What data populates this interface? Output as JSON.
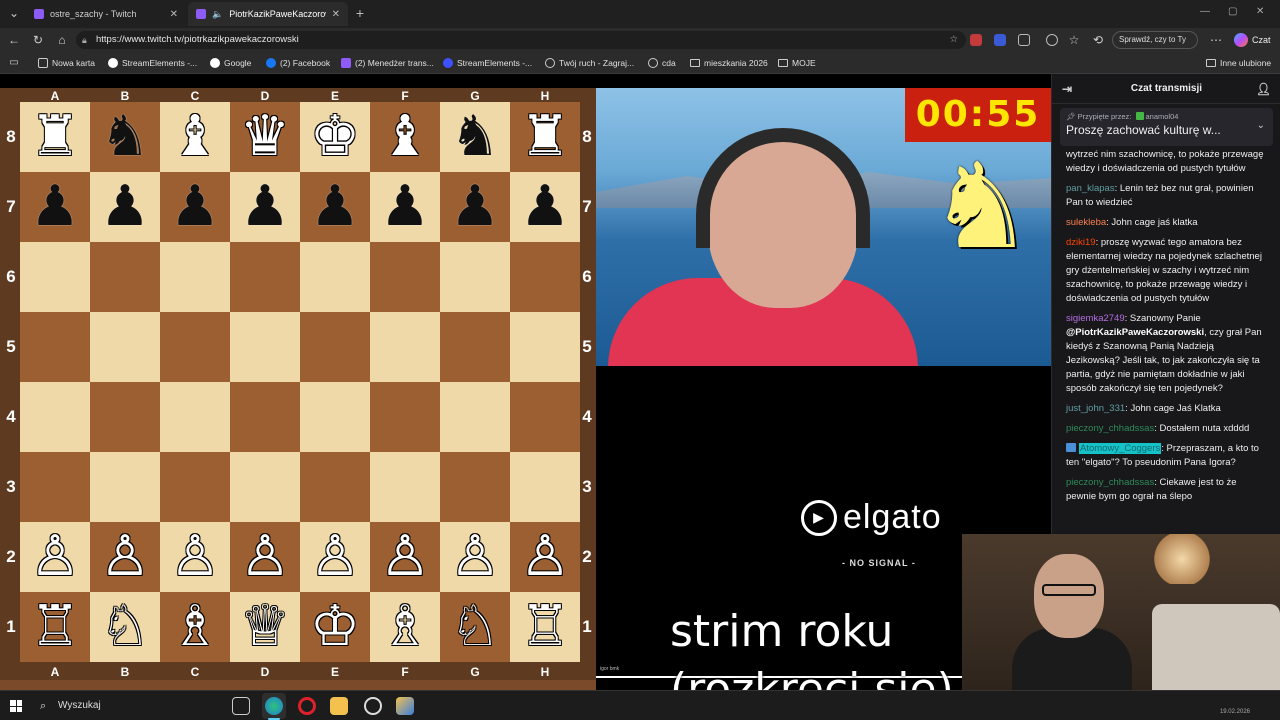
{
  "tabs": [
    {
      "title": "ostre_szachy - Twitch",
      "active": false
    },
    {
      "title": "PiotrKazikPaweKaczorowski -",
      "active": true
    }
  ],
  "address": {
    "url": "https://www.twitch.tv/piotrkazikpawekaczorowski"
  },
  "toolbar": {
    "sprawdz_label": "Sprawdź, czy to Ty",
    "czat_label": "Czat"
  },
  "bookmarks": [
    {
      "label": "Nowa karta",
      "icon": "newtab-icon",
      "color": "#ffffff"
    },
    {
      "label": "StreamElements -...",
      "icon": "streamelements-icon",
      "color": "#ffffff"
    },
    {
      "label": "Google",
      "icon": "google-icon",
      "color": "#4285f4"
    },
    {
      "label": "(2) Facebook",
      "icon": "facebook-icon",
      "color": "#1877f2"
    },
    {
      "label": "(2) Menedżer trans...",
      "icon": "twitch-icon",
      "color": "#8f5bf6"
    },
    {
      "label": "StreamElements -...",
      "icon": "streamelements-icon",
      "color": "#3f51ff"
    },
    {
      "label": "Twój ruch - Zagraj...",
      "icon": "chess-icon",
      "color": "#cccccc"
    },
    {
      "label": "cda",
      "icon": "globe-icon",
      "color": "#cccccc"
    },
    {
      "label": "mieszkania 2026",
      "icon": "folder-icon",
      "color": "#cccccc"
    },
    {
      "label": "MOJE",
      "icon": "folder-icon",
      "color": "#cccccc"
    }
  ],
  "bookmarks_other": "Inne ulubione",
  "board": {
    "files": [
      "A",
      "B",
      "C",
      "D",
      "E",
      "F",
      "G",
      "H"
    ],
    "ranks": [
      "8",
      "7",
      "6",
      "5",
      "4",
      "3",
      "2",
      "1"
    ],
    "position": [
      [
        "♜",
        "♞",
        "♝",
        "♛",
        "♚",
        "♝",
        "♞",
        "♜"
      ],
      [
        "♟",
        "♟",
        "♟",
        "♟",
        "♟",
        "♟",
        "♟",
        "♟"
      ],
      [
        "",
        "",
        "",
        "",
        "",
        "",
        "",
        ""
      ],
      [
        "",
        "",
        "",
        "",
        "",
        "",
        "",
        ""
      ],
      [
        "",
        "",
        "",
        "",
        "",
        "",
        "",
        ""
      ],
      [
        "",
        "",
        "",
        "",
        "",
        "",
        "",
        ""
      ],
      [
        "♙",
        "♙",
        "♙",
        "♙",
        "♙",
        "♙",
        "♙",
        "♙"
      ],
      [
        "♖",
        "♘",
        "♗",
        "♕",
        "♔",
        "♗",
        "♘",
        "♖"
      ]
    ],
    "piece_colors": [
      [
        "w",
        "b",
        "w",
        "w",
        "w",
        "w",
        "b",
        "w"
      ],
      [
        "b",
        "b",
        "b",
        "b",
        "b",
        "b",
        "b",
        "b"
      ],
      [
        "",
        "",
        "",
        "",
        "",
        "",
        "",
        ""
      ],
      [
        "",
        "",
        "",
        "",
        "",
        "",
        "",
        ""
      ],
      [
        "",
        "",
        "",
        "",
        "",
        "",
        "",
        ""
      ],
      [
        "",
        "",
        "",
        "",
        "",
        "",
        "",
        ""
      ],
      [
        "w",
        "w",
        "w",
        "w",
        "w",
        "w",
        "w",
        "w"
      ],
      [
        "w",
        "w",
        "w",
        "w",
        "w",
        "w",
        "w",
        "w"
      ]
    ]
  },
  "stream": {
    "timer": "00:55",
    "elgato": "elgato",
    "no_signal": "- NO SIGNAL -",
    "tiny_label": "igor bmk",
    "overlay_line1": "strim roku",
    "overlay_line2": "(rozkreci sie)"
  },
  "chat": {
    "title": "Czat transmisji",
    "pinned_by_prefix": "Przypięte przez:",
    "pinned_by_user": "anamol04",
    "pinned_message": "Proszę zachować kulturę w...",
    "messages": [
      {
        "user": "",
        "color": "#efeff1",
        "text": "wytrzeć nim szachownicę, to pokaże przewagę wiedzy i doświadczenia od pustych tytułów"
      },
      {
        "user": "pan_klapas",
        "color": "#5f9ea0",
        "text": ": Lenin też bez nut grał, powinien Pan to wiedzieć"
      },
      {
        "user": "sulekleba",
        "color": "#ff7f50",
        "text": ": John cage jaś klatka"
      },
      {
        "user": "dziki19",
        "color": "#ff4500",
        "text": ": proszę wyzwać tego amatora bez elementarnej wiedzy na pojedynek szlachetnej gry dżentelmeńskiej w szachy i wytrzeć nim szachownicę, to pokaże przewagę wiedzy i doświadczenia od pustych tytułów"
      },
      {
        "user": "sigiemka2749",
        "color": "#b36ee0",
        "text": ": Szanowny Panie ",
        "mention": "@PiotrKazikPaweKaczorowski",
        "text2": ", czy grał Pan kiedyś z Szanowną Panią Nadzieją Jezikowską? Jeśli tak, to jak zakończyła się ta partia, gdyż nie pamiętam dokładnie w jaki sposób zakończył się ten pojedynek?"
      },
      {
        "user": "just_john_331",
        "color": "#5f9ea0",
        "text": ": John cage Jaś Klatka"
      },
      {
        "user": "pieczony_chhadssas",
        "color": "#2e8b57",
        "text": ": Dostałem nuta xdddd"
      },
      {
        "user": "Atomowy_Coggers",
        "color": "#106b70",
        "badge": true,
        "highlight": true,
        "text": ": Przepraszam, a kto to ten \"elgato\"? To pseudonim Pana Igora?"
      },
      {
        "user": "pieczony_chhadssas",
        "color": "#2e8b57",
        "text": ": Ciekawe jest to że pewnie bym go ograł na ślepo"
      }
    ]
  },
  "taskbar": {
    "search_placeholder": "Wyszukaj",
    "clock": "19.02.2026"
  }
}
